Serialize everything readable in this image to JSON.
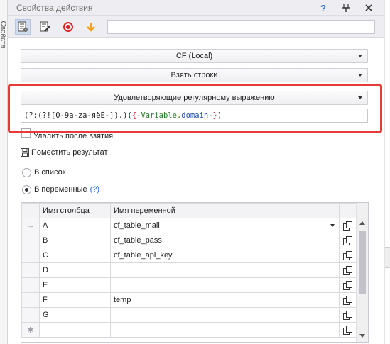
{
  "window": {
    "title": "Свойства действия",
    "help_label": "?",
    "left_strip_label": "Свойств"
  },
  "toolbar": {
    "input_value": ""
  },
  "dropdowns": {
    "source": "CF (Local)",
    "operation": "Взять строки",
    "filter": "Удовлетворяющие регулярному выражению"
  },
  "regex": {
    "prefix": "(?:(?![0-9a-za-яёЁ-]).)(",
    "brace_open": "{",
    "var_prefix": "-Variable.",
    "var_name": "domain",
    "var_suffix": "-",
    "brace_close": "}",
    "suffix": ")"
  },
  "options": {
    "delete_after_take": "Удалить после взятия",
    "save_result": "Поместить результат",
    "to_list": "В список",
    "to_vars": "В переменные",
    "help": "(?)"
  },
  "grid": {
    "headers": {
      "column": "Имя столбца",
      "variable": "Имя переменной"
    },
    "rows": [
      {
        "indicator": "→",
        "column": "A",
        "variable": "cf_table_mail"
      },
      {
        "indicator": "",
        "column": "B",
        "variable": "cf_table_pass"
      },
      {
        "indicator": "",
        "column": "C",
        "variable": "cf_table_api_key"
      },
      {
        "indicator": "",
        "column": "D",
        "variable": ""
      },
      {
        "indicator": "",
        "column": "E",
        "variable": ""
      },
      {
        "indicator": "",
        "column": "F",
        "variable": "temp"
      },
      {
        "indicator": "",
        "column": "G",
        "variable": ""
      },
      {
        "indicator": "✱",
        "column": "",
        "variable": ""
      }
    ]
  },
  "colors": {
    "highlight": "#e53b3b",
    "accent": "#2a6ad8"
  }
}
